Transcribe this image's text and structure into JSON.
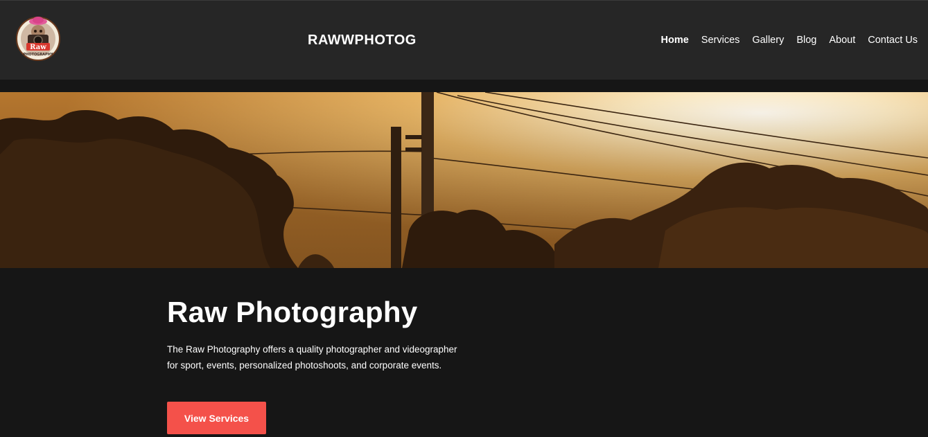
{
  "header": {
    "brand": "RAWWPHOTOG",
    "logo": {
      "banner_text": "Raw",
      "ring_text": "PHOTOGRAPHY"
    },
    "nav": [
      {
        "label": "Home",
        "active": true
      },
      {
        "label": "Services",
        "active": false
      },
      {
        "label": "Gallery",
        "active": false
      },
      {
        "label": "Blog",
        "active": false
      },
      {
        "label": "About",
        "active": false
      },
      {
        "label": "Contact Us",
        "active": false
      }
    ]
  },
  "hero": {
    "image_subject": "sunset-trees-power-lines-photo"
  },
  "content": {
    "title": "Raw Photography",
    "description": "The Raw Photography offers a quality photographer and videographer for sport, events, personalized photoshoots, and corporate events.",
    "cta_label": "View Services"
  },
  "colors": {
    "header_bg": "#262626",
    "page_bg": "#161616",
    "accent": "#f4514a",
    "text": "#ffffff"
  }
}
